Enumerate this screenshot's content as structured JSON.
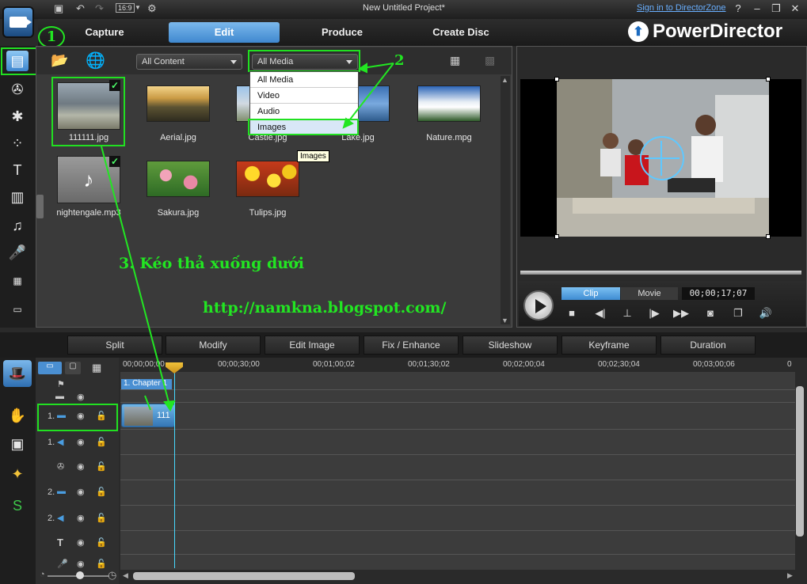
{
  "window": {
    "title": "New Untitled Project*",
    "signin": "Sign in to DirectorZone",
    "help": "?",
    "minimize": "–",
    "restore": "❐",
    "close": "✕",
    "ratio": "16:9"
  },
  "nav": {
    "tabs": [
      "Capture",
      "Edit",
      "Produce",
      "Create Disc"
    ],
    "active": "Edit",
    "brand": "PowerDirector"
  },
  "library": {
    "filter_content": "All Content",
    "filter_media": "All Media",
    "dropdown_options": [
      "All Media",
      "Video",
      "Audio",
      "Images"
    ],
    "tooltip": "Images",
    "items": [
      {
        "name": "111111.jpg",
        "checked": true
      },
      {
        "name": "Aerial.jpg",
        "checked": false
      },
      {
        "name": "Castle.jpg",
        "checked": false
      },
      {
        "name": "Lake.jpg",
        "checked": false
      },
      {
        "name": "Nature.mpg",
        "checked": false
      },
      {
        "name": "nightengale.mp3",
        "checked": true
      },
      {
        "name": "Sakura.jpg",
        "checked": false
      },
      {
        "name": "Tulips.jpg",
        "checked": false
      }
    ]
  },
  "annotations": {
    "step1": "1",
    "step2": "2",
    "step3": "3. Kéo thả xuống dưới",
    "url": "http://namkna.blogspot.com/"
  },
  "preview": {
    "mode_clip": "Clip",
    "mode_movie": "Movie",
    "timecode": "00;00;17;07"
  },
  "edit_tools": [
    "Split",
    "Modify",
    "Edit Image",
    "Fix / Enhance",
    "Slideshow",
    "Keyframe",
    "Duration"
  ],
  "timeline": {
    "ruler_labels": [
      "00;00;00;00",
      "00;00;30;00",
      "00;01;00;02",
      "00;01;30;02",
      "00;02;00;04",
      "00;02;30;04",
      "00;03;00;06",
      "0"
    ],
    "chapter": "1. Chapter 1",
    "clip_label": "111",
    "tracks": [
      "1.",
      "1.",
      "",
      "2.",
      "2.",
      "",
      ""
    ]
  },
  "colors": {
    "accent": "#3f88cf",
    "annotation_green": "#22e622",
    "playhead": "#48d8ff"
  }
}
